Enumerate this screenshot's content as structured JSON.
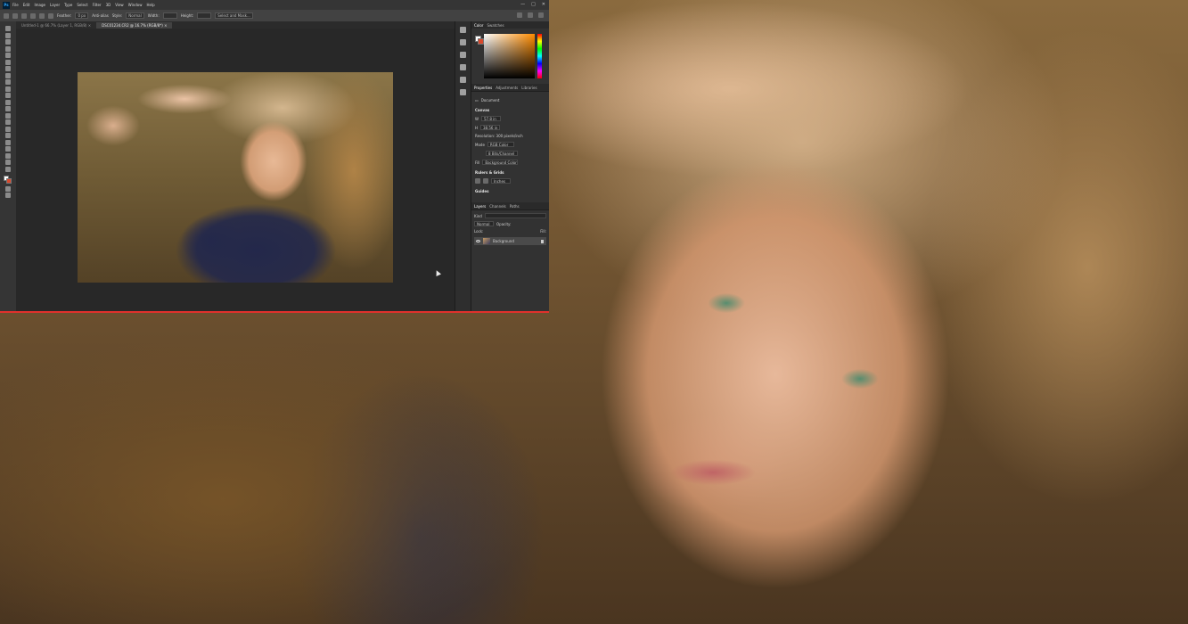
{
  "app": {
    "logo": "Ps",
    "window_controls": [
      "—",
      "□",
      "✕"
    ]
  },
  "menu": {
    "items": [
      "File",
      "Edit",
      "Image",
      "Layer",
      "Type",
      "Select",
      "Filter",
      "3D",
      "View",
      "Window",
      "Help"
    ]
  },
  "options": {
    "feather_label": "Feather:",
    "feather_value": "0 px",
    "antialias_label": "Anti-alias",
    "style_label": "Style:",
    "style_value": "Normal",
    "width_label": "Width:",
    "height_label": "Height:",
    "select_mask_label": "Select and Mask..."
  },
  "tabs": [
    {
      "label": "Untitled-1 @ 66.7% (Layer 1, RGB/8) ×"
    },
    {
      "label": "DSC01234.CR2 @ 16.7% (RGB/8*) ×"
    }
  ],
  "panels": {
    "color_tabs": [
      "Color",
      "Swatches"
    ],
    "props_tabs": [
      "Properties",
      "Adjustments",
      "Libraries"
    ],
    "doc_label": "Document",
    "canvas_label": "Canvas",
    "w_label": "W",
    "w_value": "57.8 in",
    "h_label": "H",
    "h_value": "38.56 in",
    "resolution": "Resolution: 300 pixels/inch",
    "mode_label": "Mode",
    "mode_value": "RGB Color",
    "depth_value": "8 Bits/Channel",
    "fill_label": "Fill",
    "fill_value": "Background Color",
    "rulers_label": "Rulers & Grids",
    "rulers_unit": "Inches",
    "guides_label": "Guides",
    "layers_tabs": [
      "Layers",
      "Channels",
      "Paths"
    ],
    "kind_label": "Kind",
    "blend_mode": "Normal",
    "opacity_label": "Opacity:",
    "lock_label": "Lock:",
    "fill2_label": "Fill:",
    "layer_name": "Background"
  }
}
